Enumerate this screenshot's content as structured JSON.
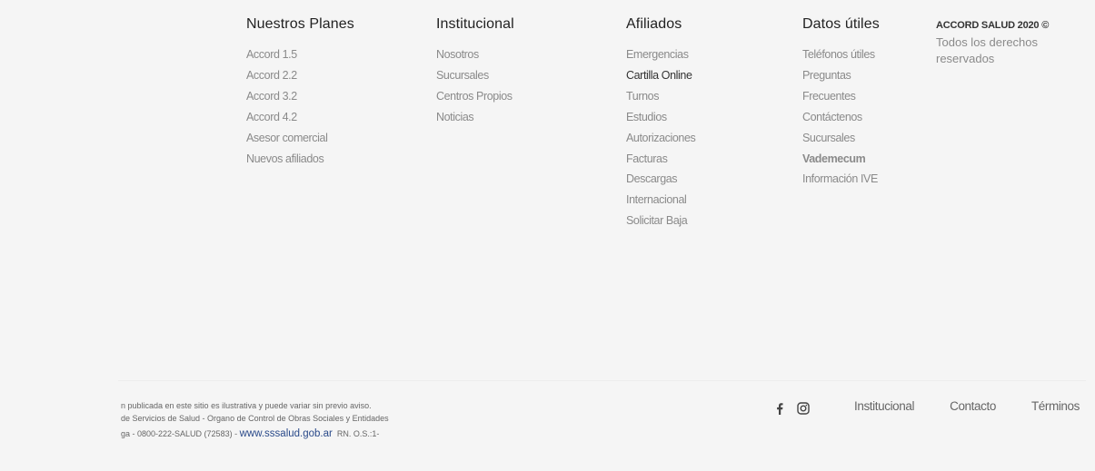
{
  "columns": {
    "planes": {
      "title": "Nuestros Planes",
      "items": [
        "Accord 1.5",
        "Accord 2.2",
        "Accord 3.2",
        "Accord 4.2",
        "Asesor comercial",
        "Nuevos afiliados"
      ]
    },
    "institucional": {
      "title": "Institucional",
      "items": [
        "Nosotros",
        "Sucursales",
        "Centros Propios",
        "Noticias"
      ]
    },
    "afiliados": {
      "title": "Afiliados",
      "items": [
        "Emergencias",
        "Cartilla Online",
        "Turnos",
        "Estudios",
        "Autorizaciones",
        "Facturas",
        "Descargas",
        "Internacional",
        "Solicitar Baja"
      ]
    },
    "datos": {
      "title": "Datos útiles",
      "items": [
        "Teléfonos útiles",
        "Preguntas",
        "Frecuentes",
        "Contáctenos",
        "Sucursales",
        "Vademecum",
        "Información IVE"
      ]
    }
  },
  "copyright": {
    "brand": "ACCORD SALUD 2020 ©",
    "rights": "Todos los derechos reservados"
  },
  "legal": {
    "line1": "n publicada en este sitio es ilustrativa y puede variar sin previo aviso.",
    "line2": "de Servicios de Salud - Organo de Control de Obras Sociales y Entidades",
    "line3_prefix": "ga - 0800-222-SALUD (72583) - ",
    "link": "www.sssalud.gob.ar",
    "rn": "RN. O.S.:1-"
  },
  "social": {
    "icons": [
      "facebook-icon",
      "instagram-icon"
    ]
  },
  "bottom_nav": [
    "Institucional",
    "Contacto",
    "Términos"
  ],
  "colors": {
    "background": "#f5f5f5",
    "heading": "#222222",
    "link": "#8a8a8a",
    "link_dark": "#333333",
    "legal_link": "#2a4a8a"
  }
}
